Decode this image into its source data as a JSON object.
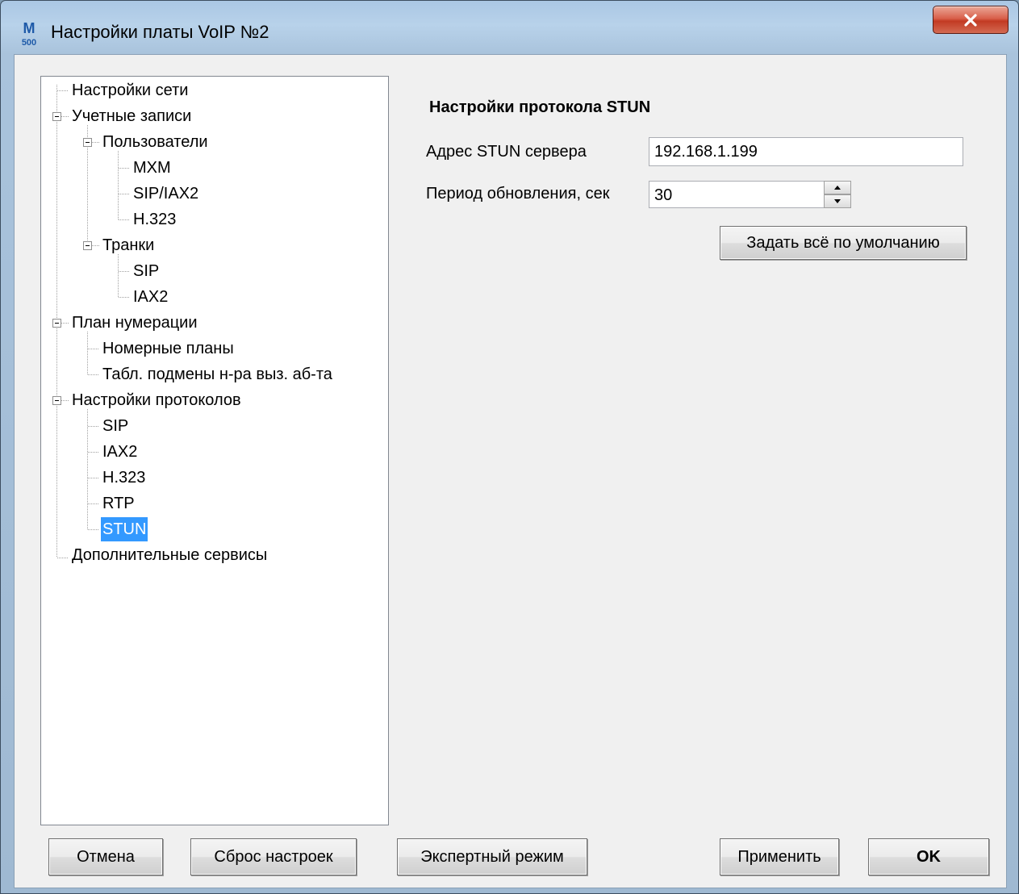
{
  "window": {
    "title": "Настройки платы VoIP №2",
    "app_icon": {
      "top": "M",
      "bottom": "500"
    }
  },
  "tree": {
    "items": [
      {
        "label": "Настройки сети"
      },
      {
        "label": "Учетные записи"
      },
      {
        "label": "Пользователи"
      },
      {
        "label": "MXM"
      },
      {
        "label": "SIP/IAX2"
      },
      {
        "label": "H.323"
      },
      {
        "label": "Транки"
      },
      {
        "label": "SIP"
      },
      {
        "label": "IAX2"
      },
      {
        "label": "План нумерации"
      },
      {
        "label": "Номерные планы"
      },
      {
        "label": "Табл. подмены н-ра выз. аб-та"
      },
      {
        "label": "Настройки протоколов"
      },
      {
        "label": "SIP"
      },
      {
        "label": "IAX2"
      },
      {
        "label": "H.323"
      },
      {
        "label": "RTP"
      },
      {
        "label": "STUN",
        "selected": true
      },
      {
        "label": "Дополнительные сервисы"
      }
    ]
  },
  "panel": {
    "title": "Настройки протокола STUN",
    "server_label": "Адрес STUN сервера",
    "server_value": "192.168.1.199",
    "period_label": "Период обновления, сек",
    "period_value": "30",
    "defaults_button": "Задать всё по умолчанию"
  },
  "buttons": {
    "cancel": "Отмена",
    "reset": "Сброс настроек",
    "expert": "Экспертный режим",
    "apply": "Применить",
    "ok": "OK"
  },
  "colors": {
    "selection": "#3399ff",
    "titlebar": "#b8d2ea",
    "close_button": "#c94a34"
  }
}
